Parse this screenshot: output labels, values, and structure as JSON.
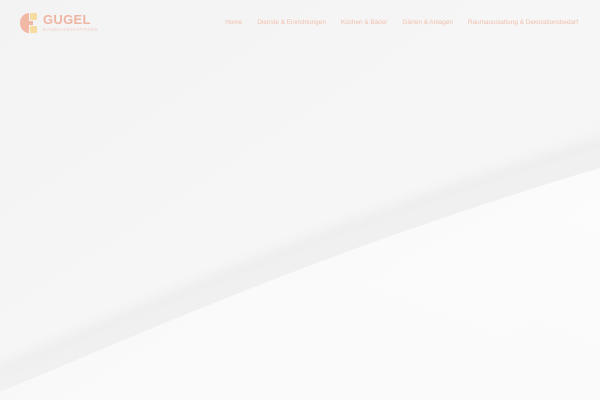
{
  "header": {
    "logo": {
      "name": "GUGEL",
      "tagline": "RAUMAUSSTATTUNG"
    },
    "nav": {
      "items": [
        {
          "label": "Home"
        },
        {
          "label": "Dienste & Einrichtungen"
        },
        {
          "label": "Küchen & Bäder"
        },
        {
          "label": "Gärten & Anlagen"
        },
        {
          "label": "Raumausstattung & Dekorationsbedarf"
        }
      ]
    }
  },
  "colors": {
    "accent": "#efb4a2",
    "accent_light": "#f0c0ae",
    "logo_yellow": "#f7dca0",
    "background": "#f5f5f5"
  },
  "icons": {
    "logo": "gugel-logo-mark-icon"
  }
}
